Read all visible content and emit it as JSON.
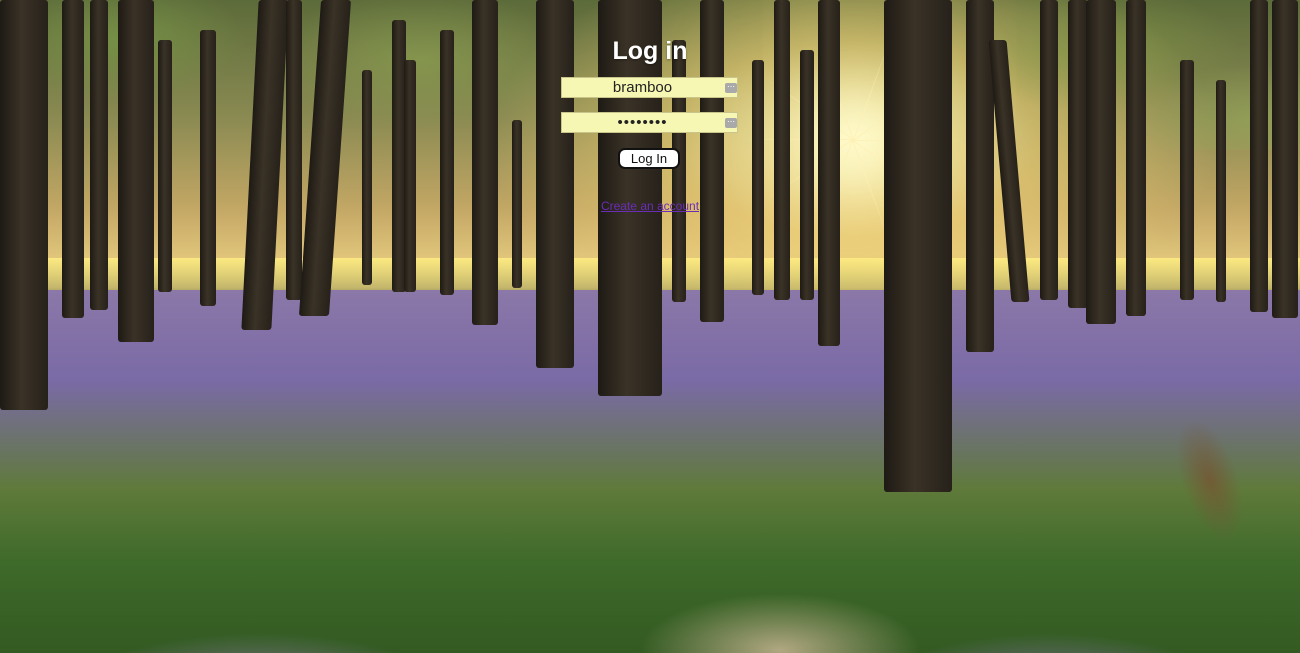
{
  "page": {
    "title": "Log in"
  },
  "form": {
    "username_value": "bramboo",
    "password_value": "••••••••",
    "login_button_label": "Log In",
    "create_account_label": "Create an account",
    "autofill_icon": "key-icon"
  },
  "colors": {
    "field_background": "#f7f7b4",
    "link": "#6a2db8",
    "title": "#ffffff"
  }
}
